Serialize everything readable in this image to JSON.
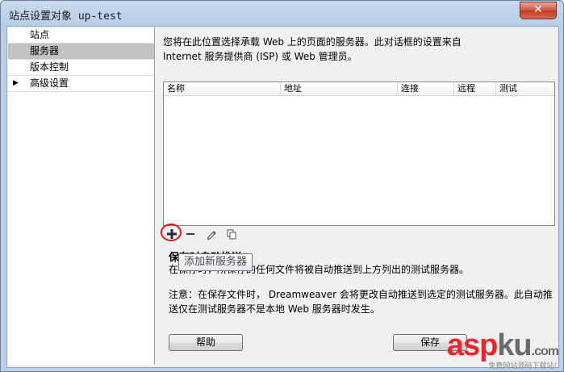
{
  "window": {
    "title": "站点设置对象 up-test",
    "close_label": "✕"
  },
  "sidebar": {
    "items": [
      {
        "label": "站点",
        "selected": false,
        "has_arrow": false
      },
      {
        "label": "服务器",
        "selected": true,
        "has_arrow": false
      },
      {
        "label": "版本控制",
        "selected": false,
        "has_arrow": false
      },
      {
        "label": "高级设置",
        "selected": false,
        "has_arrow": true,
        "arrow": "▶"
      }
    ]
  },
  "main": {
    "description_line1": "您将在此位置选择承载 Web 上的页面的服务器。此对话框的设置来自",
    "description_line2": "Internet 服务提供商 (ISP) 或 Web 管理员。",
    "table": {
      "columns": [
        "名称",
        "地址",
        "连接",
        "远程",
        "测试"
      ],
      "rows": []
    },
    "toolbar": {
      "add_icon": "plus-icon",
      "remove_icon": "minus-icon",
      "edit_icon": "pencil-icon",
      "duplicate_icon": "duplicate-icon"
    },
    "tooltip": "添加新服务器",
    "section_title": "保存时自动推送",
    "push_description": "在保存时，所保存的任何文件将被自动推送到上方列出的测试服务器。",
    "note_line1": "注意：在保存文件时， Dreamweaver 会将更改自动推送到选定的测试服务器。此自动推",
    "note_line2": "送仅在测试服务器不是本地 Web 服务器时发生。"
  },
  "footer": {
    "help_label": "帮助",
    "save_label": "保存"
  },
  "watermark": {
    "logo_red": "asp",
    "logo_gray": "ku",
    "logo_suffix": ".com",
    "subtitle": "免费网站源码下载站!"
  },
  "colors": {
    "selected_bg": "#c2c2c2",
    "highlight_ring": "#e0141e",
    "watermark_red": "#e8262b"
  }
}
